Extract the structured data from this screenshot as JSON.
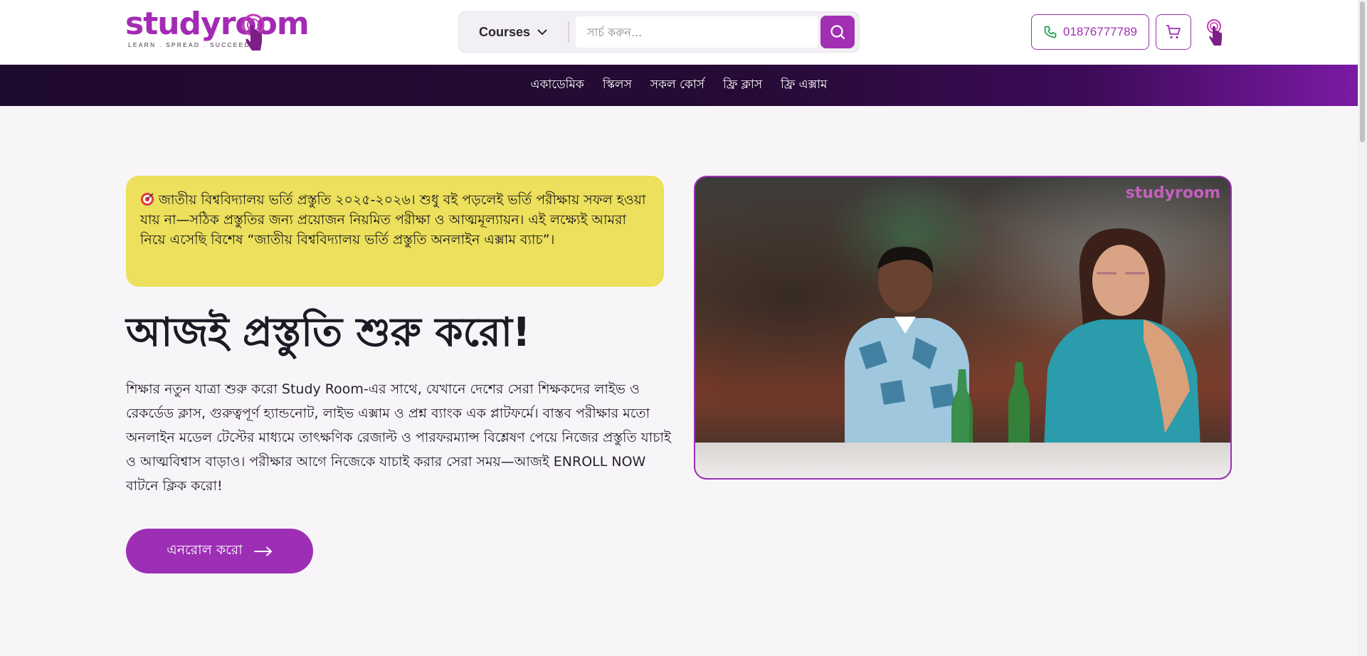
{
  "header": {
    "logo_text": "studyroom",
    "logo_tagline": "LEARN . SPREAD . SUCCEED",
    "courses_label": "Courses",
    "search_placeholder": "সার্চ করুন...",
    "phone_number": "01876777789"
  },
  "nav": {
    "items": [
      {
        "label": "একাডেমিক"
      },
      {
        "label": "স্কিলস"
      },
      {
        "label": "সকল কোর্স"
      },
      {
        "label": "ফ্রি ক্লাস"
      },
      {
        "label": "ফ্রি এক্সাম"
      }
    ]
  },
  "hero": {
    "notice": "জাতীয় বিশ্ববিদ্যালয় ভর্তি প্রস্তুতি ২০২৫-২০২৬। শুধু বই পড়লেই ভর্তি পরীক্ষায় সফল হওয়া যায় না—সঠিক প্রস্তুতির জন্য প্রয়োজন নিয়মিত পরীক্ষা ও আত্মমূল্যায়ন। এই লক্ষ্যেই আমরা নিয়ে এসেছি বিশেষ “জাতীয় বিশ্ববিদ্যালয় ভর্তি প্রস্তুতি অনলাইন এক্সাম ব্যাচ”।",
    "title": "আজই প্রস্তুতি শুরু করো!",
    "description": "শিক্ষার নতুন যাত্রা শুরু করো Study Room-এর সাথে, যেখানে দেশের সেরা শিক্ষকদের লাইভ ও রেকর্ডেড ক্লাস, গুরুত্বপূর্ণ হ্যান্ডনোট, লাইভ এক্সাম ও প্রশ্ন ব্যাংক এক প্লাটফর্মে। বাস্তব পরীক্ষার মতো অনলাইন মডেল টেস্টের মাধ্যমে তাৎক্ষণিক রেজাল্ট ও পারফরম্যান্স বিশ্লেষণ পেয়ে নিজের প্রস্তুতি যাচাই ও আত্মবিশ্বাস বাড়াও। পরীক্ষার আগে নিজেকে যাচাই করার সেরা সময়—আজই ENROLL NOW বাটনে ক্লিক করো!",
    "enroll_label": "এনরোল করো",
    "video_watermark": "studyroom"
  },
  "icons": {
    "courses": "chevron-down-icon",
    "search": "search-icon",
    "phone": "phone-icon",
    "cart": "cart-icon",
    "pointer": "pointer-hand-icon",
    "notice": "target-icon",
    "enroll": "arrow-right-icon"
  },
  "colors": {
    "brand": "#a130b4",
    "notice_bg": "#ece05c",
    "nav_bg": "#250b35",
    "page_bg": "#f8f5f9"
  }
}
